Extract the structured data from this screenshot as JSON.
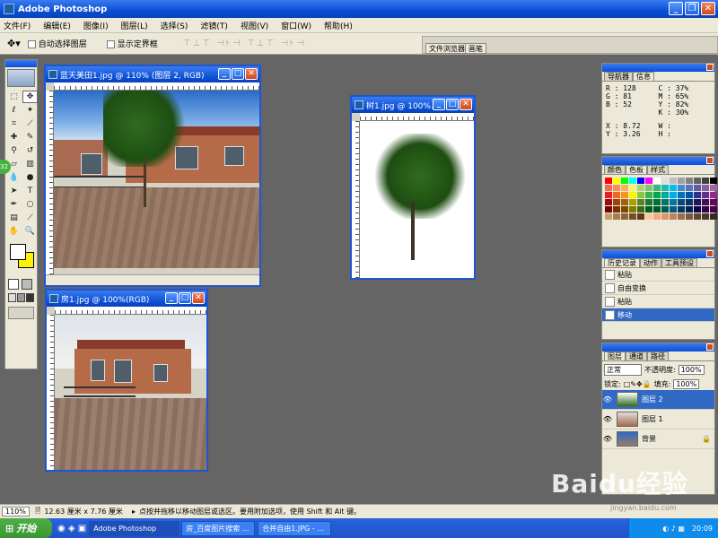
{
  "app": {
    "title": "Adobe Photoshop"
  },
  "menu": [
    "文件(F)",
    "编辑(E)",
    "图像(I)",
    "图层(L)",
    "选择(S)",
    "滤镜(T)",
    "视图(V)",
    "窗口(W)",
    "帮助(H)"
  ],
  "options": {
    "auto_select": "自动选择图层",
    "show_bounds": "显示定界框",
    "align_icons": "⊤⊥⊤ ⊣⊦⊣ ⊤⊥⊤ ⊣⊦⊣",
    "tab_browser": "文件浏览器",
    "tab_brushes": "画笔"
  },
  "docs": {
    "doc1": {
      "title": "蓝天美田1.jpg @ 110% (图层 2, RGB)"
    },
    "doc2": {
      "title": "树1.jpg @ 100%..."
    },
    "doc3": {
      "title": "房1.jpg @ 100%(RGB)"
    }
  },
  "navigator": {
    "tab1": "导航器",
    "tab2": "信息"
  },
  "info": {
    "r": "R :  128",
    "g": "G :   81",
    "b": "B :   52",
    "c": "C :  37%",
    "m": "M :  65%",
    "y": "Y :  82%",
    "k": "K :  30%",
    "x": "X :  8.72",
    "yy": "Y :  3.26",
    "w": "W :",
    "h": "H :"
  },
  "color_panel": {
    "tab1": "颜色",
    "tab2": "色板",
    "tab3": "样式"
  },
  "swatch_colors": [
    "#ff0000",
    "#ffff00",
    "#00ff00",
    "#00ffff",
    "#0000ff",
    "#ff00ff",
    "#ffffff",
    "#e0e0e0",
    "#c0c0c0",
    "#a0a0a0",
    "#808080",
    "#606060",
    "#404040",
    "#000000",
    "#f26c4f",
    "#f68e55",
    "#fbaf5c",
    "#fff467",
    "#acd372",
    "#7cc576",
    "#3bb878",
    "#1abbb4",
    "#00bff3",
    "#438ccb",
    "#5574b9",
    "#605ca8",
    "#855fa8",
    "#a763a8",
    "#ed1c24",
    "#f26522",
    "#f7941d",
    "#fff200",
    "#8dc63f",
    "#39b54a",
    "#00a651",
    "#00a99d",
    "#00aeef",
    "#0072bc",
    "#0054a6",
    "#2e3192",
    "#662d91",
    "#92278f",
    "#9e0b0f",
    "#a0410d",
    "#a3620a",
    "#aba000",
    "#598527",
    "#197b30",
    "#007236",
    "#00746b",
    "#0076a3",
    "#004b80",
    "#003471",
    "#1b1464",
    "#440e62",
    "#630460",
    "#790000",
    "#7b2e00",
    "#7d4900",
    "#827b00",
    "#406618",
    "#005e20",
    "#005826",
    "#005952",
    "#005b7f",
    "#003663",
    "#002157",
    "#0d004c",
    "#32004b",
    "#4b0049",
    "#c69c6d",
    "#a67c52",
    "#8c6239",
    "#754c24",
    "#603913",
    "#fbc8a0",
    "#f7a77c",
    "#e0956b",
    "#c18062",
    "#9b6b52",
    "#7a5745",
    "#5f4538",
    "#4a382e",
    "#362a22"
  ],
  "history": {
    "tab1": "历史记录",
    "tab2": "动作",
    "tab3": "工具预设",
    "items": [
      {
        "label": "粘贴"
      },
      {
        "label": "自由变换"
      },
      {
        "label": "粘贴"
      },
      {
        "label": "移动"
      }
    ]
  },
  "layers": {
    "tab1": "图层",
    "tab2": "通道",
    "tab3": "路径",
    "blend": "正常",
    "opacity_label": "不透明度:",
    "opacity": "100%",
    "lock_label": "锁定:",
    "fill_label": "填充:",
    "fill": "100%",
    "items": [
      {
        "name": "图层 2"
      },
      {
        "name": "图层 1"
      },
      {
        "name": "背景"
      }
    ]
  },
  "status": {
    "zoom": "110%",
    "size": "12.63 厘米 x 7.76 厘米",
    "hint": "点按并拖移以移动图层或选区。要用附加选项，使用 Shift 和 Alt 键。"
  },
  "taskbar": {
    "start": "开始",
    "tasks": [
      {
        "label": "Adobe Photoshop"
      },
      {
        "label": "房_百度图片搜索 ..."
      },
      {
        "label": "合并自由1.JPG - ..."
      }
    ],
    "time": "20:09"
  },
  "watermark": {
    "logo": "Baidu经验",
    "url": "jingyan.baidu.com"
  }
}
